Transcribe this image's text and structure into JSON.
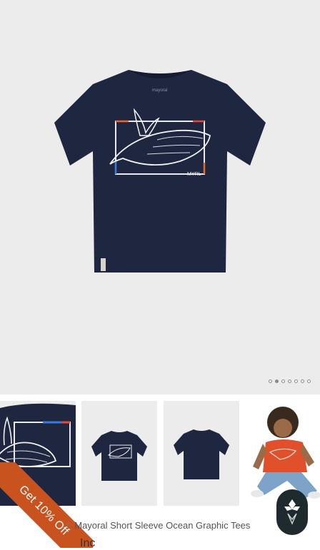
{
  "product": {
    "hero_image": "navy whale graphic tee front",
    "garment_label": "mayoral",
    "print_mark": "MYRL"
  },
  "carousel": {
    "total": 7,
    "active": 1
  },
  "thumbnails": [
    {
      "name": "detail-print"
    },
    {
      "name": "front-view"
    },
    {
      "name": "back-view"
    },
    {
      "name": "model-photo"
    }
  ],
  "promo": {
    "label": "Get 10% Off"
  },
  "breadcrumb": {
    "separator": "/",
    "current": "Mayoral Short Sleeve Ocean Graphic Tees"
  },
  "vendor": {
    "text": "Inc"
  },
  "colors": {
    "navy": "#1f2640",
    "promo": "#c9531f",
    "orange_tee": "#e0502a"
  },
  "icons": {
    "brand": "brand-logo-icon"
  }
}
